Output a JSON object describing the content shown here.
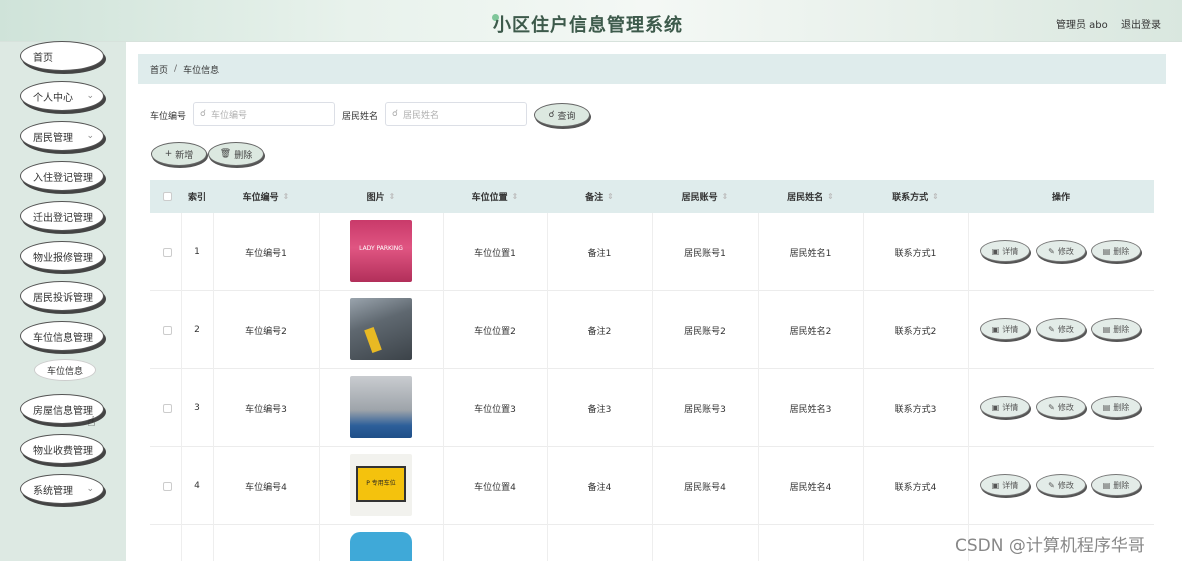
{
  "header": {
    "title": "小区住户信息管理系统",
    "user": "管理员 abo",
    "logout": "退出登录"
  },
  "sidebar": {
    "items": [
      {
        "label": "首页",
        "has_chevron": false
      },
      {
        "label": "个人中心",
        "has_chevron": true
      },
      {
        "label": "居民管理",
        "has_chevron": true
      },
      {
        "label": "入住登记管理",
        "has_chevron": false
      },
      {
        "label": "迁出登记管理",
        "has_chevron": false
      },
      {
        "label": "物业报修管理",
        "has_chevron": false
      },
      {
        "label": "居民投诉管理",
        "has_chevron": false
      },
      {
        "label": "车位信息管理",
        "has_chevron": false
      },
      {
        "label": "房屋信息管理",
        "has_chevron": false
      },
      {
        "label": "物业收费管理",
        "has_chevron": false
      },
      {
        "label": "系统管理",
        "has_chevron": true
      }
    ],
    "sub_item": "车位信息"
  },
  "breadcrumb": {
    "home": "首页",
    "sep": "/",
    "current": "车位信息"
  },
  "filters": {
    "spot_label": "车位编号",
    "spot_placeholder": "车位编号",
    "name_label": "居民姓名",
    "name_placeholder": "居民姓名",
    "query_button": "查询"
  },
  "toolbar": {
    "add_button": "新增",
    "delete_button": "删除"
  },
  "table": {
    "headers": {
      "index": "索引",
      "spot_no": "车位编号",
      "image": "图片",
      "location": "车位位置",
      "note": "备注",
      "account": "居民账号",
      "name": "居民姓名",
      "contact": "联系方式",
      "actions": "操作"
    },
    "rows": [
      {
        "index": "1",
        "spot_no": "车位编号1",
        "location": "车位位置1",
        "note": "备注1",
        "account": "居民账号1",
        "name": "居民姓名1",
        "contact": "联系方式1",
        "image_text": "LADY PARKING"
      },
      {
        "index": "2",
        "spot_no": "车位编号2",
        "location": "车位位置2",
        "note": "备注2",
        "account": "居民账号2",
        "name": "居民姓名2",
        "contact": "联系方式2",
        "image_text": ""
      },
      {
        "index": "3",
        "spot_no": "车位编号3",
        "location": "车位位置3",
        "note": "备注3",
        "account": "居民账号3",
        "name": "居民姓名3",
        "contact": "联系方式3",
        "image_text": ""
      },
      {
        "index": "4",
        "spot_no": "车位编号4",
        "location": "车位位置4",
        "note": "备注4",
        "account": "居民账号4",
        "name": "居民姓名4",
        "contact": "联系方式4",
        "image_text": "P 专用车位"
      }
    ],
    "row_actions": {
      "detail": "详情",
      "edit": "修改",
      "delete": "删除"
    }
  },
  "watermark": "CSDN @计算机程序华哥",
  "colors": {
    "sidebar_bg": "#dde9e3",
    "header_bar_bg": "#dfecec",
    "accent": "#3d5a4b"
  }
}
